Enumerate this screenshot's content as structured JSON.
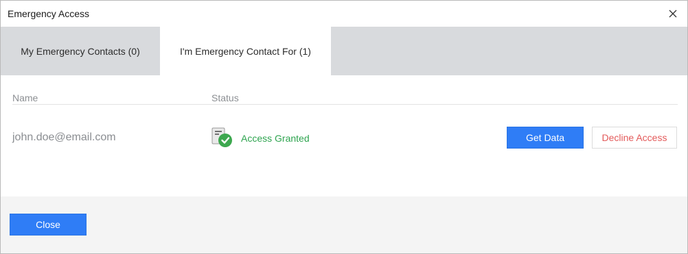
{
  "window": {
    "title": "Emergency Access"
  },
  "tabs": [
    {
      "label": "My Emergency Contacts (0)",
      "active": false
    },
    {
      "label": "I'm Emergency Contact For (1)",
      "active": true
    }
  ],
  "table": {
    "columns": [
      "Name",
      "Status"
    ],
    "rows": [
      {
        "name": "john.doe@email.com",
        "status": "Access Granted",
        "status_icon": "access-granted-icon",
        "actions": [
          "Get Data",
          "Decline Access"
        ]
      }
    ]
  },
  "footer": {
    "close_label": "Close"
  },
  "colors": {
    "primary": "#2f7df6",
    "success": "#2ea44f",
    "danger": "#e35a5a",
    "tabbar_bg": "#d8dadd"
  }
}
